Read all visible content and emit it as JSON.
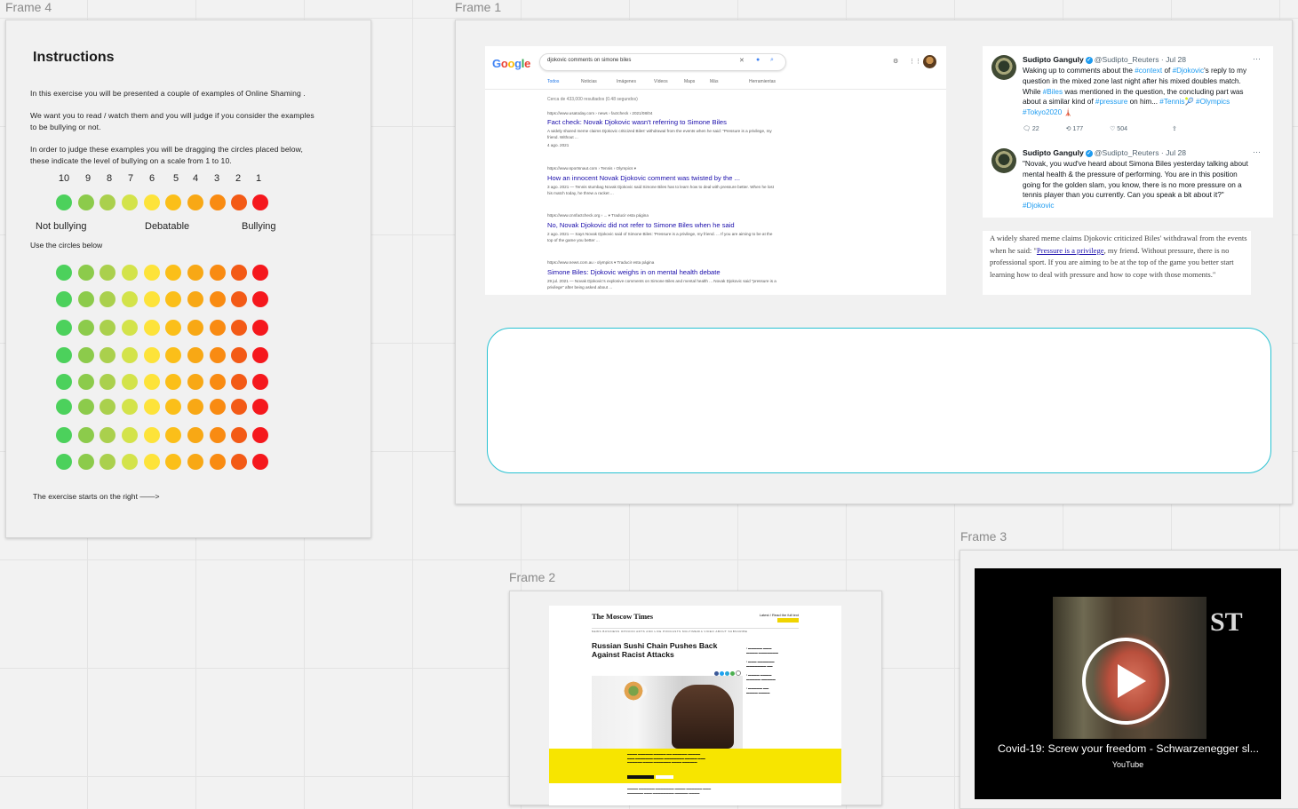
{
  "frames": {
    "f4": "Frame 4",
    "f1": "Frame 1",
    "f2": "Frame 2",
    "f3": "Frame 3"
  },
  "instructions": {
    "title": "Instructions",
    "p1": "In this exercise you will be presented a couple of examples of  Online Shaming  .",
    "p2": "We want you to read / watch them and you will judge if you consider the examples to be bullying or not.",
    "p3": "In order to judge these examples you will be dragging the circles placed below, these indicate the level of bullying on a scale from 1 to 10.",
    "scale_numbers": [
      "10",
      "9",
      "8",
      "7",
      "6",
      "5",
      "4",
      "3",
      "2",
      "1"
    ],
    "label_not": "Not bullying",
    "label_mid": "Debatable",
    "label_bully": "Bullying",
    "use_circles": "Use the circles below",
    "start": "The exercise starts on the right ——>",
    "circle_colors": [
      "#4cd15c",
      "#8ccb4b",
      "#aad04d",
      "#d3e34a",
      "#fde33a",
      "#fbbf19",
      "#f8a815",
      "#f98b12",
      "#f35a16",
      "#f5181d"
    ],
    "circle_rows": 8
  },
  "google": {
    "logo": "Google",
    "query": "djokovic comments on simone biles",
    "tabs": [
      "Todos",
      "Noticias",
      "Imágenes",
      "Vídeos",
      "Maps",
      "Más",
      "Herramientas"
    ],
    "count": "Cerca de 433,000 resultados (0.48 segundos)",
    "results": [
      {
        "url": "https://www.usatoday.com › news › factcheck › 2021/08/04",
        "title": "Fact check: Novak Djokovic wasn't referring to Simone Biles",
        "snippet": "A widely shared meme claims Djokovic criticized Biles' withdrawal from the events when he said: \"Pressure is a privilege, my friend. Without ...",
        "date": "4 ago. 2021"
      },
      {
        "url": "https://www.sportsnaut.com › Tennis › Olympics ▾",
        "title": "How an innocent Novak Djokovic comment was twisted by the ...",
        "snippet": "3 ago. 2021 — Tennis stumbag Novak Djokovic said Simone Biles has to learn how to deal with pressure better. When he lost his match today, he threw a racket ...",
        "date": ""
      },
      {
        "url": "https://www.cnnfactcheck.org › ... ▾  Traducir esta página",
        "title": "No, Novak Djokovic did not refer to Simone Biles when he said",
        "snippet": "2 ago. 2021 — Says Novak Djokovic said of Simone Biles: 'Pressure is a privilege, my friend. ... If you are aiming to be at the top of the game you better ...",
        "date": ""
      },
      {
        "url": "https://www.news.com.au › olympics ▾  Traducir esta página",
        "title": "Simone Biles: Djokovic weighs in on mental health debate",
        "snippet": "29 jul. 2021 — Novak Djokovic's explosive comments on Simone Biles and mental health ... Novak Djokovic said \"pressure is a privilege\" after being asked about ...",
        "date": ""
      }
    ]
  },
  "tweets": [
    {
      "name": "Sudipto Ganguly",
      "handle": "@Sudipto_Reuters · Jul 28",
      "text_parts": [
        [
          "Waking up to comments about the ",
          ""
        ],
        [
          "#context",
          "link"
        ],
        [
          " of ",
          ""
        ],
        [
          "#Djokovic",
          "link"
        ],
        [
          "'s reply to my question in the mixed zone last night after his mixed doubles match. While ",
          ""
        ],
        [
          "#Biles",
          "link"
        ],
        [
          " was mentioned in the question, the concluding part was about a similar kind of ",
          ""
        ],
        [
          "#pressure",
          "link"
        ],
        [
          " on him... ",
          ""
        ],
        [
          "#Tennis",
          "link"
        ],
        [
          "🎾 ",
          ""
        ],
        [
          "#Olympics",
          "link"
        ],
        [
          " ",
          ""
        ],
        [
          "#Tokyo2020",
          "link"
        ],
        [
          " 🗼",
          ""
        ]
      ],
      "replies": "22",
      "retweets": "177",
      "likes": "504"
    },
    {
      "name": "Sudipto Ganguly",
      "handle": "@Sudipto_Reuters · Jul 28",
      "text_parts": [
        [
          "\"Novak, you wud've heard about Simona Biles yesterday talking about mental health & the pressure of performing. You are in this position going for the golden slam, you know, there is no more pressure on a tennis player than you currently. Can you speak a bit about it?\" ",
          ""
        ],
        [
          "#Djokovic",
          "link"
        ]
      ]
    }
  ],
  "quote": {
    "before": "A widely shared  meme claims Djokovic criticized Biles' withdrawal from the events when he said: \"",
    "link": "Pressure is a privilege",
    "after": ", my friend. Without pressure, there is no professional sport. If you are aiming to be at the top of the game you better start learning how to deal with pressure and how to cope with those moments.\""
  },
  "moscow": {
    "logo": "The Moscow Times",
    "top": "Latest / Read the full text",
    "headline": "Russian Sushi Chain Pushes Back Against Racist Attacks",
    "nav": "NEWS   BUSINESS   OPINION   ARTS AND LIFE   PODCASTS   MULTIMEDIA   VIDEO   ABOUT   SUBSCRIBE"
  },
  "video": {
    "logo": "ST",
    "title": "Covid-19: Screw your freedom - Schwarzenegger sl...",
    "source": "YouTube"
  }
}
